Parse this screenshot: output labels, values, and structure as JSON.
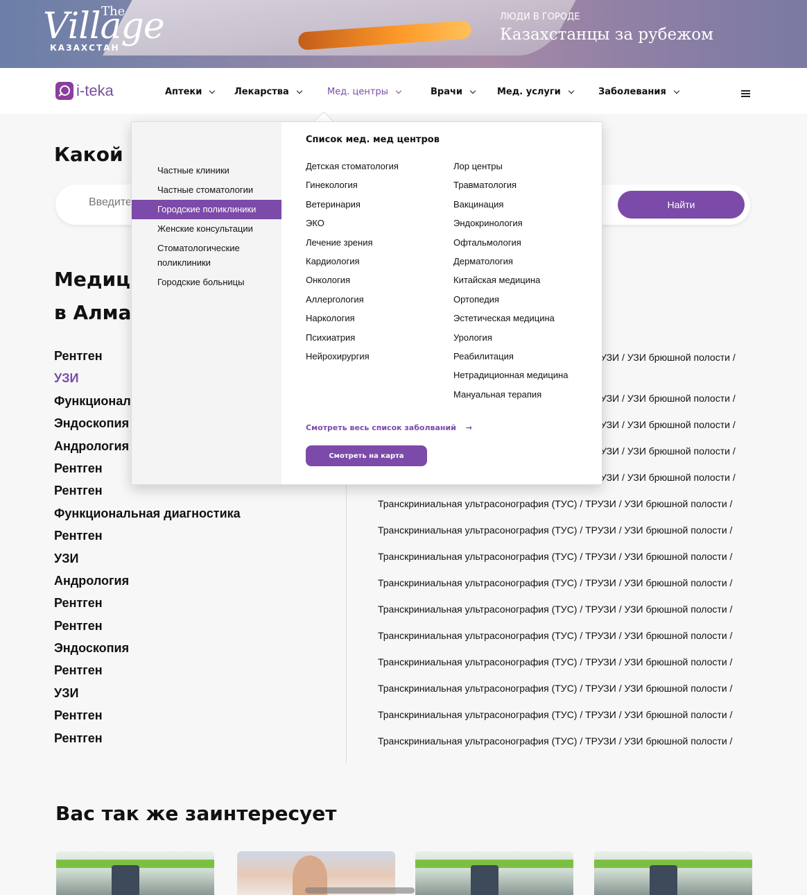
{
  "banner": {
    "logo_the": "The",
    "logo_name": "Village",
    "logo_country": "КАЗАХСТАН",
    "kicker": "ЛЮДИ В ГОРОДЕ",
    "title": "Казахстанцы за рубежом"
  },
  "nav": {
    "brand": "i-teka",
    "items": [
      {
        "label": "Аптеки"
      },
      {
        "label": "Лекарства"
      },
      {
        "label": "Мед. центры"
      },
      {
        "label": "Врачи"
      },
      {
        "label": "Мед. услуги"
      },
      {
        "label": "Заболевания"
      }
    ],
    "accent_color": "#7c4aa8"
  },
  "search": {
    "heading": "Какой п",
    "placeholder": "Введите",
    "button": "Найти"
  },
  "section": {
    "heading_line1": "Медиц",
    "heading_line2": "в Алма"
  },
  "categories": [
    "Рентген",
    "УЗИ",
    "Функционал",
    "Эндоскопия",
    "Андрология",
    "Рентген",
    "Рентген",
    "Функциональная диагностика",
    "Рентген",
    "УЗИ",
    "Андрология",
    "Рентген",
    "Рентген",
    "Эндоскопия",
    "Рентген",
    "УЗИ",
    "Рентген",
    "Рентген"
  ],
  "services": {
    "short_rows": [
      "УЗИ / УЗИ брюшной полости /",
      "УЗИ / УЗИ брюшной полости /",
      "УЗИ / УЗИ брюшной полости /",
      "УЗИ / УЗИ брюшной полости /",
      "УЗИ / УЗИ брюшной полости /"
    ],
    "full_rows": [
      "Транскриниальная ультрасонография (ТУС) / ТРУЗИ / УЗИ брюшной полости /",
      "Транскриниальная ультрасонография (ТУС) / ТРУЗИ / УЗИ брюшной полости /",
      "Транскриниальная ультрасонография (ТУС) / ТРУЗИ / УЗИ брюшной полости /",
      "Транскриниальная ультрасонография (ТУС) / ТРУЗИ / УЗИ брюшной полости /",
      "Транскриниальная ультрасонография (ТУС) / ТРУЗИ / УЗИ брюшной полости /",
      "Транскриниальная ультрасонография (ТУС) / ТРУЗИ / УЗИ брюшной полости /",
      "Транскриниальная ультрасонография (ТУС) / ТРУЗИ / УЗИ брюшной полости /",
      "Транскриниальная ультрасонография (ТУС) / ТРУЗИ / УЗИ брюшной полости /",
      "Транскриниальная ультрасонография (ТУС) / ТРУЗИ / УЗИ брюшной полости /",
      "Транскриниальная ультрасонография (ТУС) / ТРУЗИ / УЗИ брюшной полости /"
    ]
  },
  "interest": {
    "heading": "Вас так же заинтересует"
  },
  "dropdown": {
    "side_items": [
      {
        "label": "Частные клиники"
      },
      {
        "label": "Частные стоматологии"
      },
      {
        "label": "Городские поликлиники"
      },
      {
        "label": "Женские консультации"
      },
      {
        "label": "Стоматологические поликлиники"
      },
      {
        "label": "Городские больницы"
      }
    ],
    "title": "Список мед. мед центров",
    "col1": [
      "Детская стоматология",
      "Гинекология",
      "Ветеринария",
      "ЭКО",
      "Лечение зрения",
      "Кардиология",
      "Онкология",
      "Аллергология",
      "Наркология",
      "Психиатрия",
      "Нейрохирургия"
    ],
    "col2": [
      "Лор центры",
      "Травматология",
      "Вакцинация",
      "Эндокринология",
      "Офтальмология",
      "Дерматология",
      "Китайская медицина",
      "Ортопедия",
      "Эстетическая медицина",
      "Урология",
      "Реабилитация",
      "Нетрадиционная медицина",
      "Мануальная терапия"
    ],
    "see_all": "Смотреть весь список заболваний",
    "arrow": "→",
    "map_button": "Смотреть на карта"
  }
}
